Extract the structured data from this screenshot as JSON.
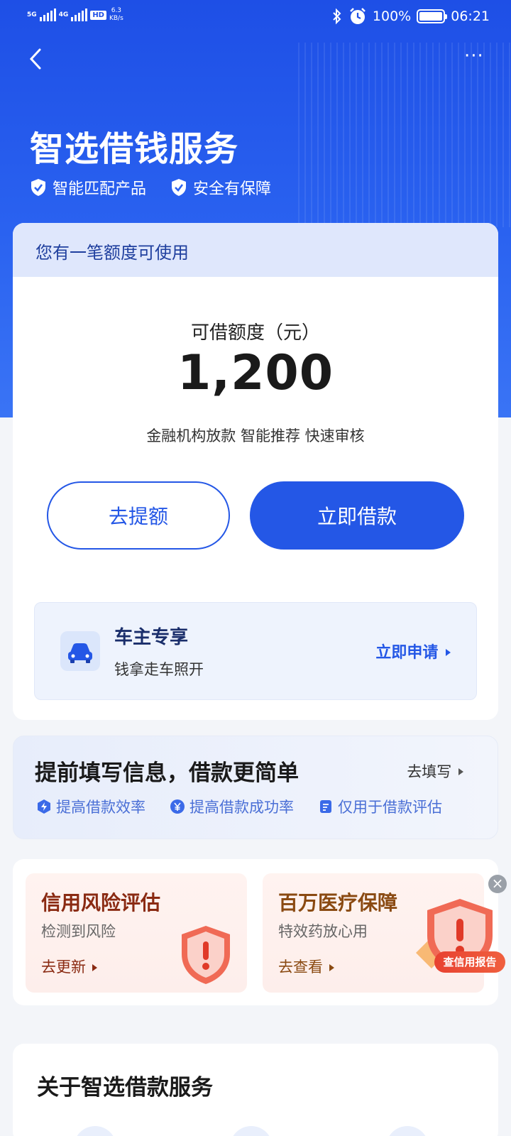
{
  "status_bar": {
    "net1": "5G",
    "net2": "4G",
    "hd": "HD",
    "speed_value": "6.3",
    "speed_unit": "KB/s",
    "battery": "100%",
    "time": "06:21"
  },
  "header": {
    "more": "···",
    "title": "智选借钱服务",
    "features": [
      "智能匹配产品",
      "安全有保障"
    ]
  },
  "quota_card": {
    "notice": "您有一笔额度可使用",
    "label": "可借额度（元）",
    "amount": "1,200",
    "tags": "金融机构放款 智能推荐 快速审核",
    "raise_button": "去提额",
    "borrow_button": "立即借款",
    "car": {
      "title": "车主专享",
      "subtitle": "钱拿走车照开",
      "link": "立即申请"
    }
  },
  "info_card": {
    "title": "提前填写信息，借款更简单",
    "link": "去填写",
    "features": [
      "提高借款效率",
      "提高借款成功率",
      "仅用于借款评估"
    ]
  },
  "promos": [
    {
      "title": "信用风险评估",
      "subtitle": "检测到风险",
      "link": "去更新"
    },
    {
      "title": "百万医疗保障",
      "subtitle": "特效药放心用",
      "link": "去查看"
    }
  ],
  "float_ad": {
    "close": "×",
    "badge": "查信用报告"
  },
  "about": {
    "title": "关于智选借款服务"
  },
  "colors": {
    "primary": "#2457e6",
    "hero_top": "#1e4fe6",
    "promo_title": "#8a2a12",
    "danger": "#e84130"
  }
}
